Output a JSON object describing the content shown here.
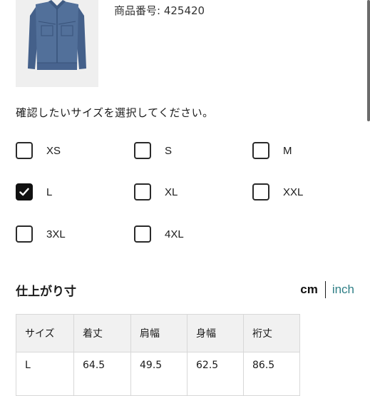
{
  "product": {
    "number_label": "商品番号: 425420",
    "image_alt": "denim-jacket"
  },
  "size_picker": {
    "prompt": "確認したいサイズを選択してください。",
    "options": [
      {
        "label": "XS",
        "checked": false
      },
      {
        "label": "S",
        "checked": false
      },
      {
        "label": "M",
        "checked": false
      },
      {
        "label": "L",
        "checked": true
      },
      {
        "label": "XL",
        "checked": false
      },
      {
        "label": "XXL",
        "checked": false
      },
      {
        "label": "3XL",
        "checked": false
      },
      {
        "label": "4XL",
        "checked": false
      }
    ]
  },
  "measurements": {
    "title": "仕上がり寸",
    "unit_cm": "cm",
    "unit_inch": "inch",
    "active_unit": "cm",
    "columns": [
      "サイズ",
      "着丈",
      "肩幅",
      "身幅",
      "裄丈"
    ],
    "rows": [
      [
        "L",
        "64.5",
        "49.5",
        "62.5",
        "86.5"
      ]
    ]
  },
  "colors": {
    "accent_link": "#2f7f86",
    "checked_fill": "#111111",
    "table_header_bg": "#f1f1f1"
  }
}
